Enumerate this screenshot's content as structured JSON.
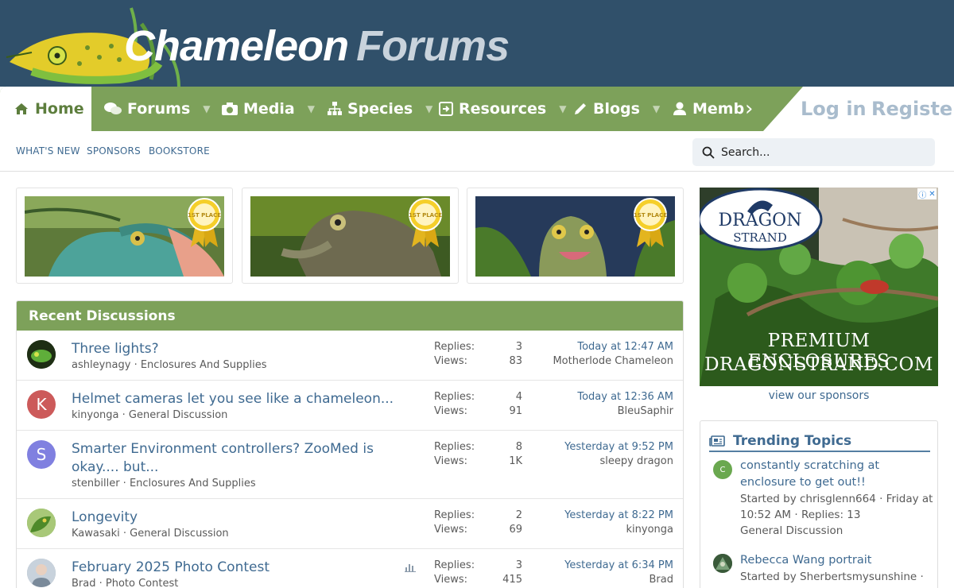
{
  "header": {
    "logo_word1": "Chameleon",
    "logo_word2": "Forums"
  },
  "nav": {
    "home": "Home",
    "items": [
      {
        "label": "Forums",
        "icon": "comments-icon"
      },
      {
        "label": "Media",
        "icon": "camera-icon"
      },
      {
        "label": "Species",
        "icon": "sitemap-icon"
      },
      {
        "label": "Resources",
        "icon": "download-icon"
      },
      {
        "label": "Blogs",
        "icon": "pencil-icon"
      },
      {
        "label": "Memb",
        "icon": "user-icon"
      }
    ],
    "more_arrow": "›",
    "login": "Log in",
    "register": "Register"
  },
  "subnav": {
    "links": [
      "WHAT'S NEW",
      "SPONSORS",
      "BOOKSTORE"
    ],
    "search_placeholder": "Search..."
  },
  "promos": [
    {
      "badge": "1ST PLACE"
    },
    {
      "badge": "1ST PLACE"
    },
    {
      "badge": "1ST PLACE"
    }
  ],
  "recent": {
    "heading": "Recent Discussions",
    "replies_label": "Replies:",
    "views_label": "Views:",
    "threads": [
      {
        "title": "Three lights?",
        "author": "ashleynagy",
        "forum": "Enclosures And Supplies",
        "replies": "3",
        "views": "83",
        "last_time": "Today at 12:47 AM",
        "last_user": "Motherlode Chameleon",
        "avatar_letter": "",
        "avatar_color": "#2f4a1e"
      },
      {
        "title": "Helmet cameras let you see like a chameleon...",
        "author": "kinyonga",
        "forum": "General Discussion",
        "replies": "4",
        "views": "91",
        "last_time": "Today at 12:36 AM",
        "last_user": "BleuSaphir",
        "avatar_letter": "K",
        "avatar_color": "#cc5a5a"
      },
      {
        "title": "Smarter Environment controllers? ZooMed is okay.... but...",
        "author": "stenbiller",
        "forum": "Enclosures And Supplies",
        "replies": "8",
        "views": "1K",
        "last_time": "Yesterday at 9:52 PM",
        "last_user": "sleepy dragon",
        "avatar_letter": "S",
        "avatar_color": "#8080e0"
      },
      {
        "title": "Longevity",
        "author": "Kawasaki",
        "forum": "General Discussion",
        "replies": "2",
        "views": "69",
        "last_time": "Yesterday at 8:22 PM",
        "last_user": "kinyonga",
        "avatar_letter": "",
        "avatar_color": "#6a9a3a"
      },
      {
        "title": "February 2025 Photo Contest",
        "author": "Brad",
        "forum": "Photo Contest",
        "replies": "3",
        "views": "415",
        "last_time": "Yesterday at 6:34 PM",
        "last_user": "Brad",
        "avatar_letter": "",
        "avatar_color": "#9aa6b2"
      }
    ]
  },
  "ad": {
    "brand_line1": "DRAGON",
    "brand_line2": "STRAND",
    "tagline1": "PREMIUM ENCLOSURES",
    "tagline2": "DRAGONSTRAND.COM"
  },
  "sponsors_link": "view our sponsors",
  "trending": {
    "heading": "Trending Topics",
    "items": [
      {
        "title": "constantly scratching at enclosure to get out!!",
        "meta": "Started by chrisglenn664 · Friday at 10:52 AM · Replies: 13",
        "forum": "General Discussion",
        "avatar_letter": "C",
        "avatar_color": "#6aa84f"
      },
      {
        "title": "Rebecca Wang portrait",
        "meta": "Started by Sherbertsmysunshine ·",
        "forum": "",
        "avatar_letter": "",
        "avatar_color": "#4a6a4a"
      }
    ]
  }
}
